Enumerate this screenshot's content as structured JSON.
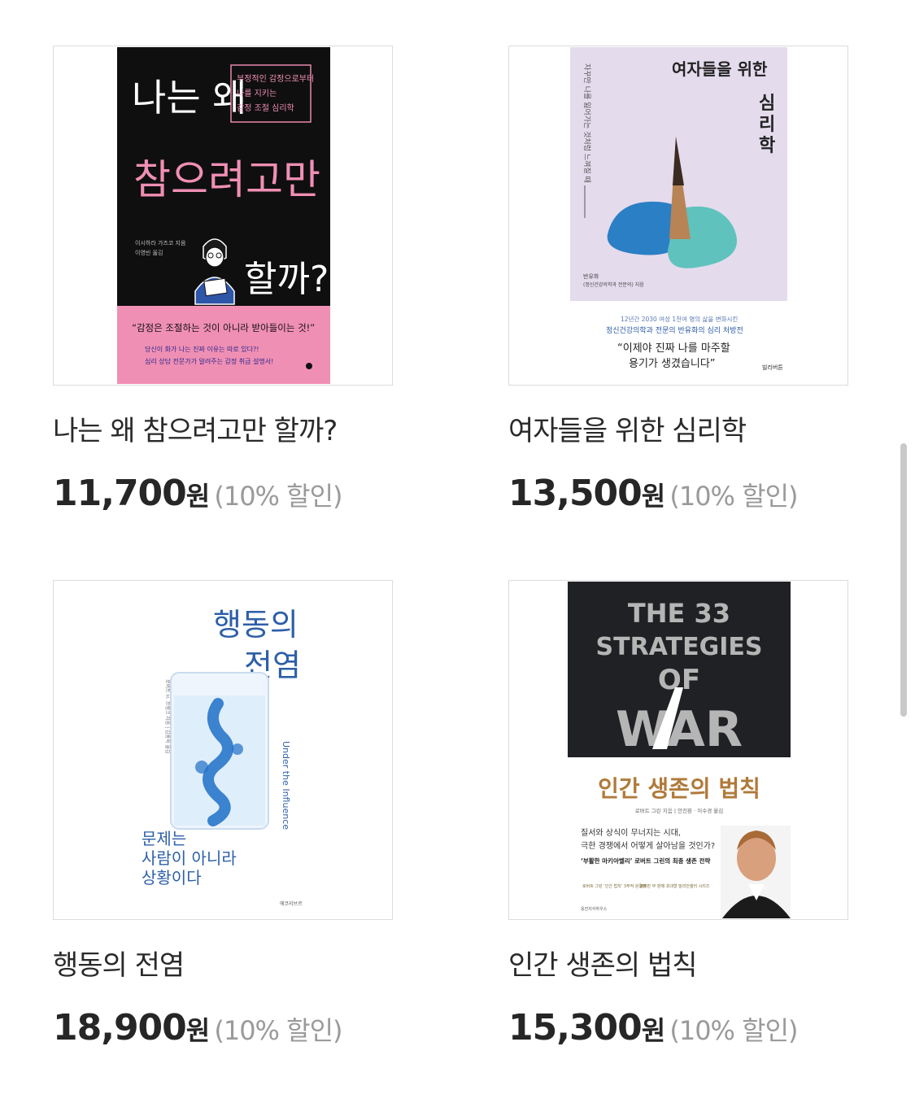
{
  "products": [
    {
      "title": "나는 왜 참으려고만 할까?",
      "price": "11,700",
      "currency": "원",
      "discount": "(10% 할인)",
      "cover": {
        "headline_top": "나는 왜",
        "headline_main": "참으려고만",
        "headline_end": "할까?",
        "box_line1": "부정적인 감정으로부터",
        "box_line2": "나를 지키는",
        "box_line3": "감정 조절 심리학",
        "author": "이시하라 가즈코 지음",
        "translator": "이영빈 옮김",
        "quote": "“감정은 조절하는 것이 아니라 받아들이는 것!”",
        "sub1": "당신이 화가 나는 진짜 이유는 따로 있다?!",
        "sub2": "심리 상담 전문가가 알려주는 감정 취급 설명서!"
      }
    },
    {
      "title": "여자들을 위한 심리학",
      "price": "13,500",
      "currency": "원",
      "discount": "(10% 할인)",
      "cover": {
        "title_top": "여자들을 위한",
        "title_side_1": "심",
        "title_side_2": "리",
        "title_side_3": "학",
        "vertical": "자꾸만 나를 잃어가는 것처럼 느껴질 때",
        "author": "반유화",
        "author_sub": "(정신건강의학과 전문의) 지음",
        "blurb1": "12년간 2030 여성 1천여 명의 삶을 변화시킨",
        "blurb2": "정신건강의학과 전문의 반유화의 심리 처방전",
        "quote1": "“이제야 진짜 나를 마주할",
        "quote2": "용기가 생겼습니다”",
        "publisher": "빌리버튼"
      }
    },
    {
      "title": "행동의 전염",
      "price": "18,900",
      "currency": "원",
      "discount": "(10% 할인)",
      "cover": {
        "title1": "행동의",
        "title2": "전염",
        "english": "Under the Influence",
        "vertical": "로버트 H. 프랭크 지음 | 김홍옥 옮김",
        "tagline1": "문제는",
        "tagline2": "사람이 아니라",
        "tagline3": "상황이다",
        "publisher": "에코리브르"
      }
    },
    {
      "title": "인간 생존의 법칙",
      "price": "15,300",
      "currency": "원",
      "discount": "(10% 할인)",
      "cover": {
        "en1": "THE 33",
        "en2": "STRATEGIES",
        "en3": "OF",
        "en4": "WAR",
        "ko_title": "인간 생존의 법칙",
        "credits": "로버트 그린 지음 | 안진환 · 이수경 옮김",
        "line1": "질서와 상식이 무너지는 시대,",
        "line2": "극한 경쟁에서 어떻게 살아남을 것인가?",
        "line3": "‘부활한 마키아벨리’ 로버트 그린의 최종 생존 전략",
        "badge1": "로버트 그린 ‘인간 법칙’ 3부작 완결판",
        "badge2": "200만 부 판매 초대형 밀리언셀러 시리즈",
        "publisher": "웅진지식하우스"
      }
    }
  ]
}
